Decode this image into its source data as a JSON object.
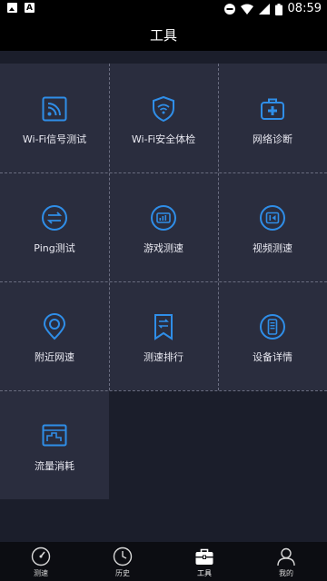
{
  "status_bar": {
    "time": "08:59",
    "icons": [
      "image-notification-icon",
      "a-notification-icon",
      "do-not-disturb-icon",
      "wifi-icon",
      "signal-icon",
      "battery-icon"
    ]
  },
  "header": {
    "title": "工具"
  },
  "colors": {
    "accent": "#2f8ee8",
    "cell_bg": "#2a2d3e",
    "page_bg": "#1b1e2b",
    "bar_bg": "#000000"
  },
  "tools": [
    {
      "label": "Wi-Fi信号测试",
      "icon": "wifi-signal-icon"
    },
    {
      "label": "Wi-Fi安全体检",
      "icon": "wifi-shield-icon"
    },
    {
      "label": "网络诊断",
      "icon": "first-aid-kit-icon"
    },
    {
      "label": "Ping测试",
      "icon": "ping-arrows-icon"
    },
    {
      "label": "游戏测速",
      "icon": "game-speed-icon"
    },
    {
      "label": "视频测速",
      "icon": "video-speed-icon"
    },
    {
      "label": "附近网速",
      "icon": "location-pin-icon"
    },
    {
      "label": "测速排行",
      "icon": "ranking-bookmark-icon"
    },
    {
      "label": "设备详情",
      "icon": "phone-device-icon"
    },
    {
      "label": "流量消耗",
      "icon": "data-usage-icon"
    }
  ],
  "bottom_nav": [
    {
      "label": "测速",
      "icon": "speedometer-icon",
      "active": false
    },
    {
      "label": "历史",
      "icon": "clock-icon",
      "active": false
    },
    {
      "label": "工具",
      "icon": "toolbox-icon",
      "active": true
    },
    {
      "label": "我的",
      "icon": "user-icon",
      "active": false
    }
  ]
}
